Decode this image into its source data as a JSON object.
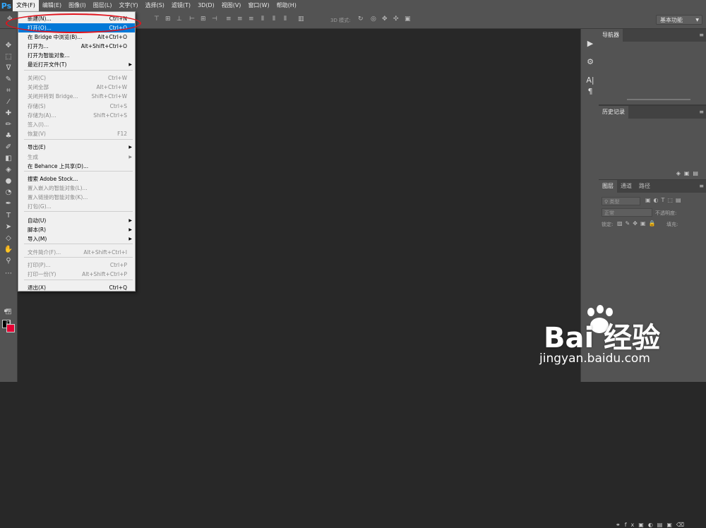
{
  "app": {
    "logo": "Ps"
  },
  "menubar": {
    "items": [
      "文件(F)",
      "编辑(E)",
      "图像(I)",
      "图层(L)",
      "文字(Y)",
      "选择(S)",
      "滤镜(T)",
      "3D(D)",
      "视图(V)",
      "窗口(W)",
      "帮助(H)"
    ]
  },
  "optionsbar": {
    "mode3d": "3D 模式:",
    "workspace": "基本功能"
  },
  "file_menu": {
    "items": [
      {
        "label": "新建(N)...",
        "shortcut": "Ctrl+N",
        "disabled": false
      },
      {
        "label": "打开(O)...",
        "shortcut": "Ctrl+O",
        "disabled": false,
        "highlight": true
      },
      {
        "label": "在 Bridge 中浏览(B)...",
        "shortcut": "Alt+Ctrl+O",
        "disabled": false
      },
      {
        "label": "打开为...",
        "shortcut": "Alt+Shift+Ctrl+O",
        "disabled": false
      },
      {
        "label": "打开为智能对象...",
        "shortcut": "",
        "disabled": false
      },
      {
        "label": "最近打开文件(T)",
        "shortcut": "",
        "disabled": false,
        "submenu": true
      },
      {
        "label": "关闭(C)",
        "shortcut": "Ctrl+W",
        "disabled": true
      },
      {
        "label": "关闭全部",
        "shortcut": "Alt+Ctrl+W",
        "disabled": true
      },
      {
        "label": "关闭并转到 Bridge...",
        "shortcut": "Shift+Ctrl+W",
        "disabled": true
      },
      {
        "label": "存储(S)",
        "shortcut": "Ctrl+S",
        "disabled": true
      },
      {
        "label": "存储为(A)...",
        "shortcut": "Shift+Ctrl+S",
        "disabled": true
      },
      {
        "label": "签入(I)...",
        "shortcut": "",
        "disabled": true
      },
      {
        "label": "恢复(V)",
        "shortcut": "F12",
        "disabled": true
      },
      {
        "label": "导出(E)",
        "shortcut": "",
        "disabled": false,
        "submenu": true
      },
      {
        "label": "生成",
        "shortcut": "",
        "disabled": true,
        "submenu": true
      },
      {
        "label": "在 Behance 上共享(D)...",
        "shortcut": "",
        "disabled": false
      },
      {
        "label": "搜索 Adobe Stock...",
        "shortcut": "",
        "disabled": false
      },
      {
        "label": "置入嵌入的智能对象(L)...",
        "shortcut": "",
        "disabled": true
      },
      {
        "label": "置入链接的智能对象(K)...",
        "shortcut": "",
        "disabled": true
      },
      {
        "label": "打包(G)...",
        "shortcut": "",
        "disabled": true
      },
      {
        "label": "自动(U)",
        "shortcut": "",
        "disabled": false,
        "submenu": true
      },
      {
        "label": "脚本(R)",
        "shortcut": "",
        "disabled": false,
        "submenu": true
      },
      {
        "label": "导入(M)",
        "shortcut": "",
        "disabled": false,
        "submenu": true
      },
      {
        "label": "文件简介(F)...",
        "shortcut": "Alt+Shift+Ctrl+I",
        "disabled": true
      },
      {
        "label": "打印(P)...",
        "shortcut": "Ctrl+P",
        "disabled": true
      },
      {
        "label": "打印一份(Y)",
        "shortcut": "Alt+Shift+Ctrl+P",
        "disabled": true
      },
      {
        "label": "退出(X)",
        "shortcut": "Ctrl+Q",
        "disabled": false
      }
    ]
  },
  "panels": {
    "navigator": {
      "tab": "导航器"
    },
    "history": {
      "tab": "历史记录"
    },
    "layers": {
      "tabs": [
        "图层",
        "通道",
        "路径"
      ],
      "kind_placeholder": "类型",
      "blend_mode": "正常",
      "opacity_label": "不透明度:",
      "lock_label": "锁定:",
      "fill_label": "填充:"
    }
  },
  "watermark": {
    "brand": "Bai  经验",
    "url": "jingyan.baidu.com"
  }
}
